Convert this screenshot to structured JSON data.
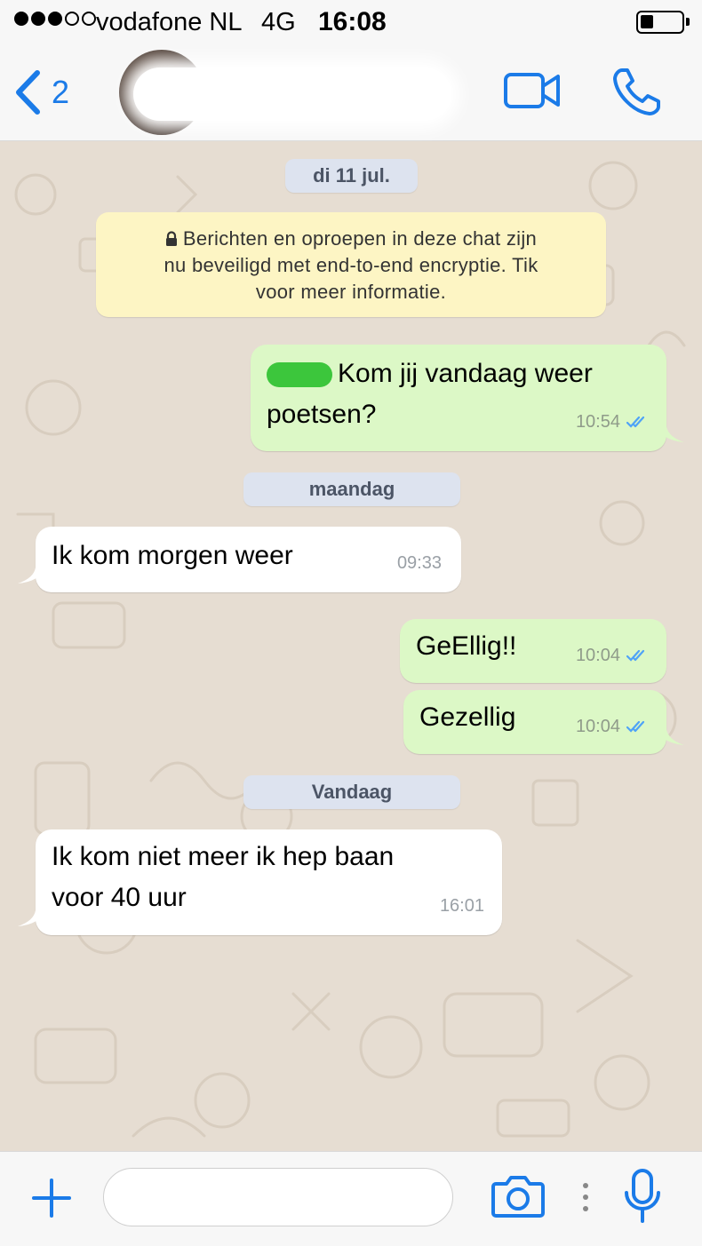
{
  "status_bar": {
    "carrier": "vodafone NL",
    "network": "4G",
    "time": "16:08",
    "signal_bars_filled": 3,
    "signal_bars_total": 5
  },
  "header": {
    "back_icon": "chevron-left-icon",
    "unread_count": "2",
    "contact_name": "",
    "video_icon": "video-camera-icon",
    "call_icon": "phone-icon"
  },
  "chat": {
    "date_chips": [
      "di 11 jul.",
      "maandag",
      "Vandaag"
    ],
    "encryption_notice": {
      "icon": "lock-icon",
      "lines": [
        "Berichten en oproepen in deze chat zijn",
        "nu beveiligd met end-to-end encryptie. Tik",
        "voor meer informatie."
      ]
    },
    "messages": [
      {
        "direction": "outgoing",
        "lines": [
          "Kom jij vandaag weer",
          "poetsen?"
        ],
        "time": "10:54",
        "status_icon": "double-check-icon"
      },
      {
        "direction": "incoming",
        "lines": [
          "Ik  kom morgen  weer"
        ],
        "time": "09:33"
      },
      {
        "direction": "outgoing",
        "lines": [
          "GeEllig!!"
        ],
        "time": "10:04",
        "status_icon": "double-check-icon"
      },
      {
        "direction": "outgoing",
        "lines": [
          "Gezellig"
        ],
        "time": "10:04",
        "status_icon": "double-check-icon"
      },
      {
        "direction": "incoming",
        "lines": [
          "Ik kom niet meer ik hep baan",
          "voor 40 uur"
        ],
        "time": "16:01"
      }
    ]
  },
  "input_bar": {
    "placeholder": "",
    "plus_icon": "plus-icon",
    "camera_icon": "camera-icon",
    "mic_icon": "microphone-icon"
  },
  "colors": {
    "accent": "#1b7be8",
    "outgoing_bubble": "#dcf8c6",
    "incoming_bubble": "#ffffff",
    "chat_background": "#e6ddd2",
    "date_chip": "#dde3ef",
    "encryption_notice": "#fdf5c4",
    "read_receipt": "#4fa3f7"
  }
}
